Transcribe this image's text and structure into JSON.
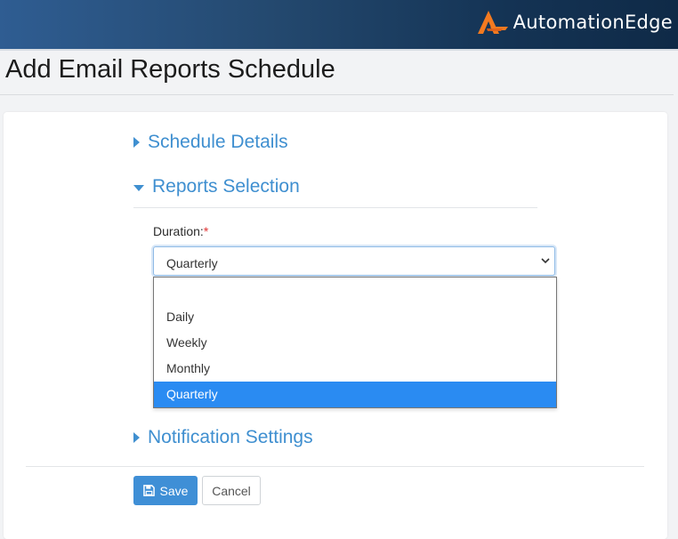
{
  "header": {
    "brand_name": "AutomationEdge",
    "logo_icon": "automationedge-logo-icon",
    "logo_color": "#f47a20"
  },
  "page": {
    "title": "Add Email Reports Schedule"
  },
  "sections": {
    "schedule_details": {
      "label": "Schedule Details",
      "expanded": false
    },
    "reports_selection": {
      "label": "Reports Selection",
      "expanded": true
    },
    "notification_settings": {
      "label": "Notification Settings",
      "expanded": false
    }
  },
  "duration": {
    "label": "Duration:",
    "required_mark": "*",
    "selected_value": "Quarterly",
    "options": [
      "",
      "Daily",
      "Weekly",
      "Monthly",
      "Quarterly"
    ],
    "selected_index": 4
  },
  "actions": {
    "save_label": "Save",
    "save_icon": "floppy-disk-icon",
    "cancel_label": "Cancel"
  },
  "colors": {
    "accent": "#3f8fd0",
    "selected_option": "#2a8bf2",
    "required": "#e03131"
  }
}
